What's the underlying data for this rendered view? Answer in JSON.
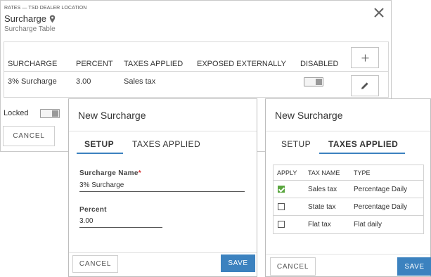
{
  "page": {
    "breadcrumb": "RATES — TSD DEALER LOCATION",
    "title": "Surcharge",
    "subtitle": "Surcharge Table",
    "close_icon": "close-icon",
    "table": {
      "headers": [
        "SURCHARGE",
        "PERCENT",
        "TAXES APPLIED",
        "EXPOSED EXTERNALLY",
        "DISABLED"
      ],
      "rows": [
        {
          "surcharge": "3% Surcharge",
          "percent": "3.00",
          "taxes_applied": "Sales tax",
          "exposed_externally": "",
          "disabled": false
        }
      ],
      "add_icon": "plus-icon",
      "edit_icon": "pencil-icon"
    },
    "locked_label": "Locked",
    "locked": false,
    "cancel_label": "CANCEL"
  },
  "dialog_setup": {
    "title": "New Surcharge",
    "tabs": [
      "SETUP",
      "TAXES APPLIED"
    ],
    "active_tab": "SETUP",
    "surcharge_name_label": "Surcharge Name",
    "surcharge_name_value": "3% Surcharge",
    "percent_label": "Percent",
    "percent_value": "3.00",
    "cancel_label": "CANCEL",
    "save_label": "SAVE"
  },
  "dialog_taxes": {
    "title": "New Surcharge",
    "tabs": [
      "SETUP",
      "TAXES APPLIED"
    ],
    "active_tab": "TAXES APPLIED",
    "headers": [
      "APPLY",
      "TAX NAME",
      "TYPE"
    ],
    "rows": [
      {
        "apply": true,
        "tax_name": "Sales tax",
        "type": "Percentage Daily"
      },
      {
        "apply": false,
        "tax_name": "State tax",
        "type": "Percentage Daily"
      },
      {
        "apply": false,
        "tax_name": "Flat tax",
        "type": "Flat daily"
      }
    ],
    "cancel_label": "CANCEL",
    "save_label": "SAVE"
  },
  "colors": {
    "accent": "#3c82bf",
    "check": "#5aa63f",
    "required": "#d32f2f"
  }
}
